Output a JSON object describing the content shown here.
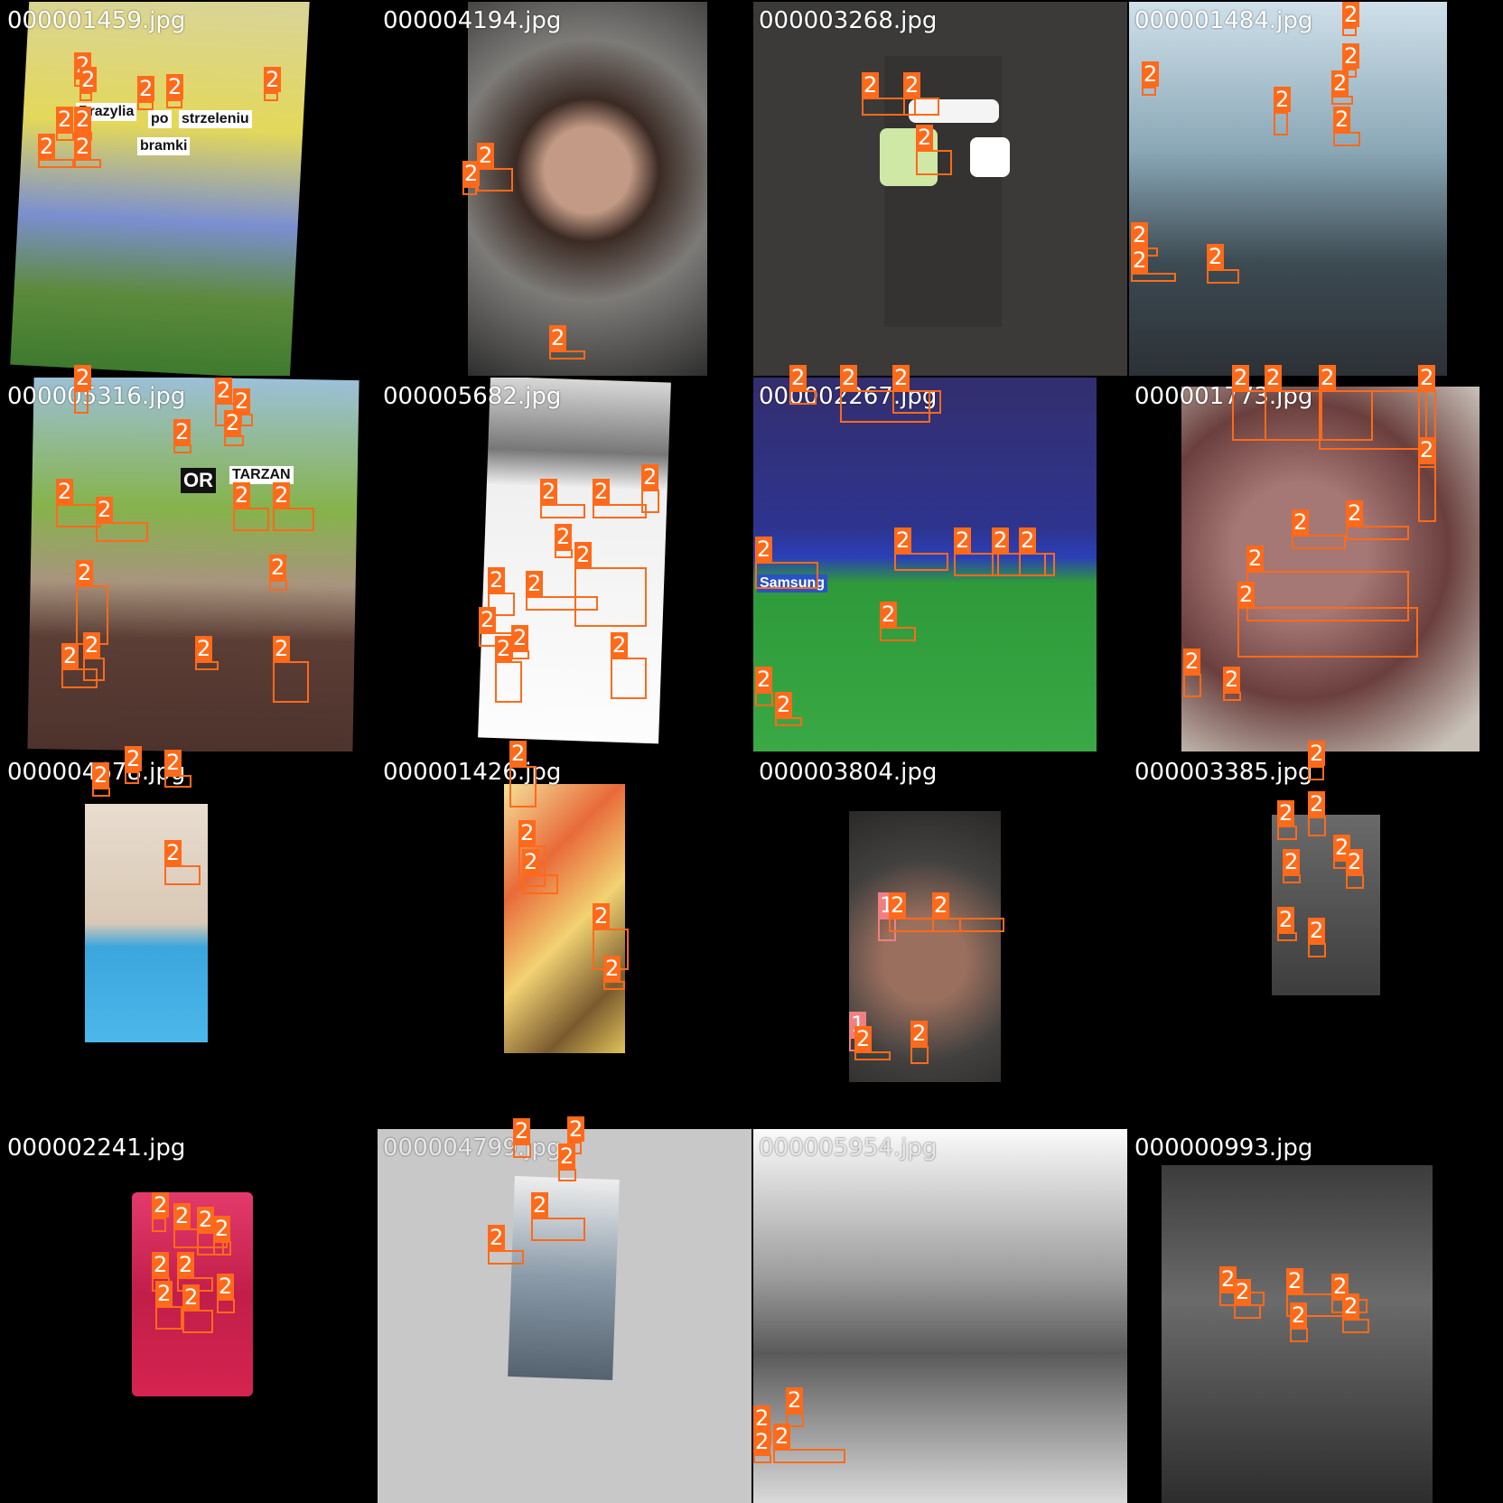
{
  "colors": {
    "box_class_2": "#ff6a1a",
    "box_class_1": "#f08080",
    "label_text": "#ffffff"
  },
  "tiles": [
    {
      "filename": "000001459.jpg",
      "ocr": [
        "Brazylia",
        "po",
        "strzeleniu",
        "bramki"
      ]
    },
    {
      "filename": "000004194.jpg"
    },
    {
      "filename": "000003268.jpg"
    },
    {
      "filename": "000001484.jpg"
    },
    {
      "filename": "000005316.jpg",
      "ocr": [
        "OR",
        "TARZAN"
      ]
    },
    {
      "filename": "000005682.jpg"
    },
    {
      "filename": "000002267.jpg",
      "ocr": [
        "Samsung"
      ]
    },
    {
      "filename": "000001773.jpg"
    },
    {
      "filename": "000004678.jpg"
    },
    {
      "filename": "000001426.jpg"
    },
    {
      "filename": "000003804.jpg"
    },
    {
      "filename": "000003385.jpg"
    },
    {
      "filename": "000002241.jpg"
    },
    {
      "filename": "000004799.jpg"
    },
    {
      "filename": "000005954.jpg"
    },
    {
      "filename": "000000993.jpg"
    }
  ]
}
